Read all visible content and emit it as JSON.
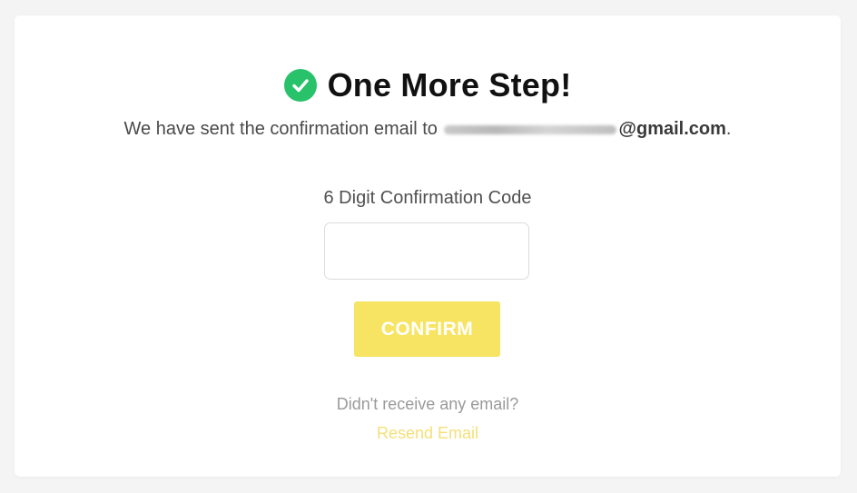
{
  "header": {
    "title": "One More Step!",
    "check_icon": "check-circle-icon",
    "check_color": "#28c26a"
  },
  "message": {
    "prefix": "We have sent the confirmation email to",
    "email_domain": "@gmail.com",
    "suffix": "."
  },
  "form": {
    "code_label": "6 Digit Confirmation Code",
    "code_value": "",
    "confirm_label": "CONFIRM",
    "confirm_color": "#f7e462"
  },
  "footer": {
    "no_email_text": "Didn't receive any email?",
    "resend_label": "Resend Email",
    "resend_color": "#f5e07a"
  }
}
